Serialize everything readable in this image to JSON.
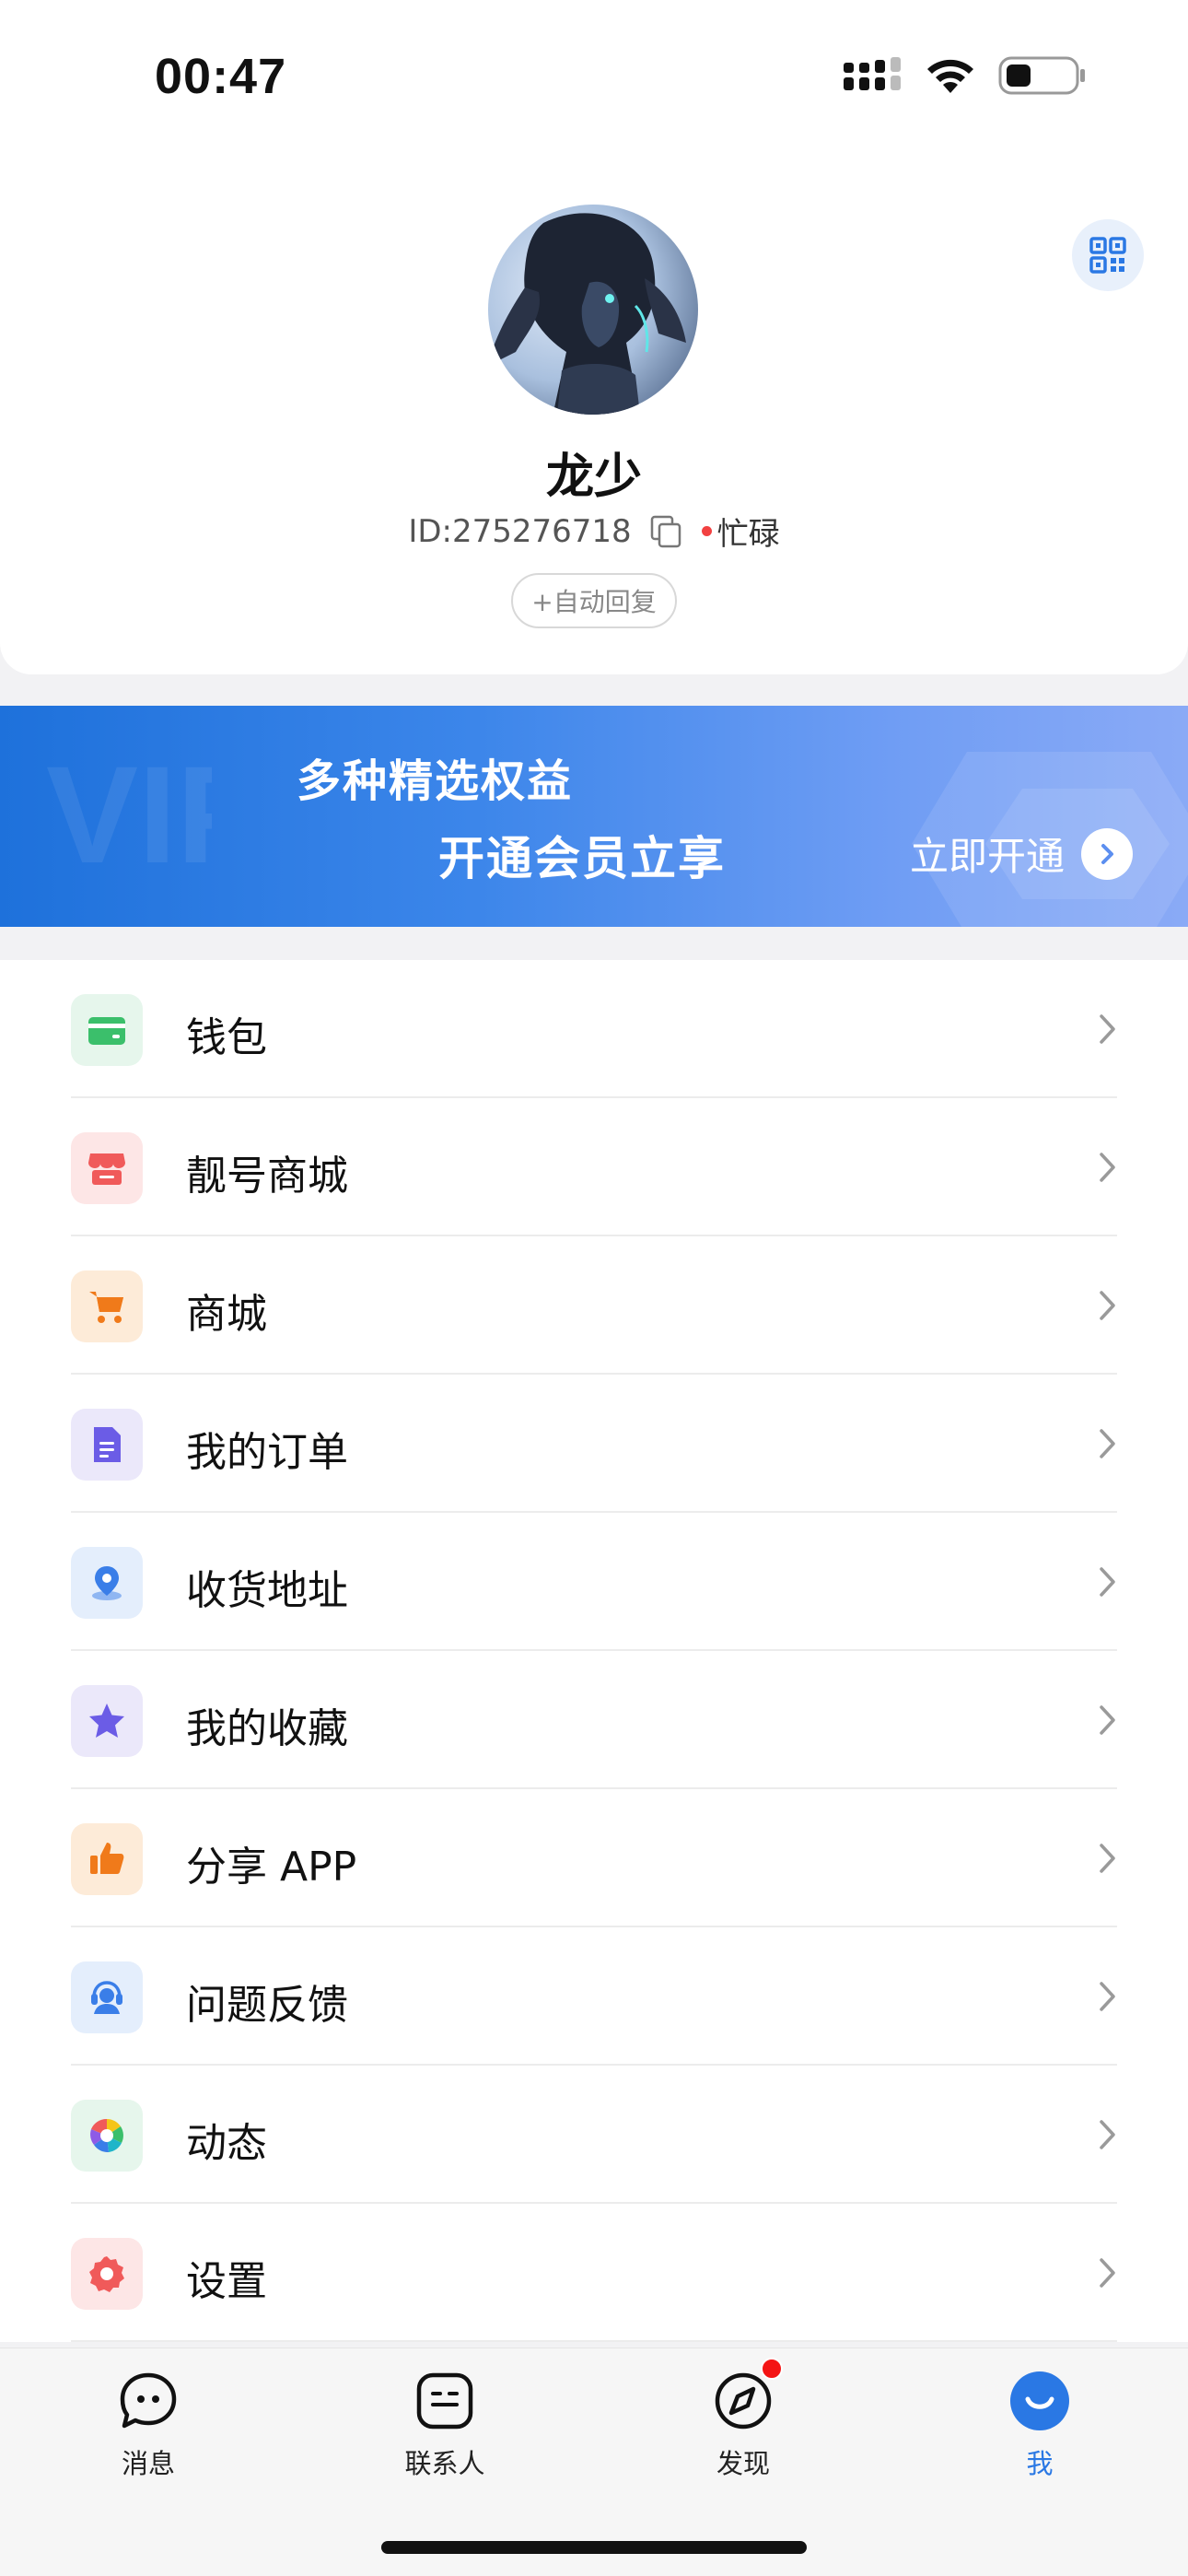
{
  "status_bar": {
    "time": "00:47"
  },
  "profile": {
    "username": "龙少",
    "id_text": "ID:275276718",
    "status_text": "忙碌",
    "auto_reply_label": "+自动回复"
  },
  "vip_banner": {
    "line1": "多种精选权益",
    "line2": "开通会员立享",
    "cta": "立即开通",
    "watermark": "VIP"
  },
  "menu": {
    "items": [
      {
        "label": "钱包",
        "icon": "wallet-icon",
        "bg": "#e6f6ec",
        "color": "#3bbf6b"
      },
      {
        "label": "靓号商城",
        "icon": "store-icon",
        "bg": "#fde6e6",
        "color": "#f05a5a"
      },
      {
        "label": "商城",
        "icon": "cart-icon",
        "bg": "#fdebd8",
        "color": "#f07a1a"
      },
      {
        "label": "我的订单",
        "icon": "document-icon",
        "bg": "#ebe8fa",
        "color": "#6b5ce6"
      },
      {
        "label": "收货地址",
        "icon": "location-icon",
        "bg": "#e4eefc",
        "color": "#3a7ee8"
      },
      {
        "label": "我的收藏",
        "icon": "star-icon",
        "bg": "#ebe8fa",
        "color": "#6b5ce6"
      },
      {
        "label": "分享 APP",
        "icon": "thumbs-up-icon",
        "bg": "#fdebd8",
        "color": "#f07a1a"
      },
      {
        "label": "问题反馈",
        "icon": "headset-icon",
        "bg": "#e4eefc",
        "color": "#3a7ee8"
      },
      {
        "label": "动态",
        "icon": "aperture-icon",
        "bg": "#e6f6ec",
        "color": "#3bbf6b"
      },
      {
        "label": "设置",
        "icon": "gear-icon",
        "bg": "#fde6e6",
        "color": "#f05a5a"
      }
    ]
  },
  "tabbar": {
    "tabs": [
      {
        "label": "消息",
        "icon": "message-icon"
      },
      {
        "label": "联系人",
        "icon": "contacts-icon"
      },
      {
        "label": "发现",
        "icon": "compass-icon",
        "badge": true
      },
      {
        "label": "我",
        "icon": "me-icon",
        "active": true
      }
    ]
  },
  "colors": {
    "accent": "#2a78e4",
    "badge": "#f41414"
  }
}
